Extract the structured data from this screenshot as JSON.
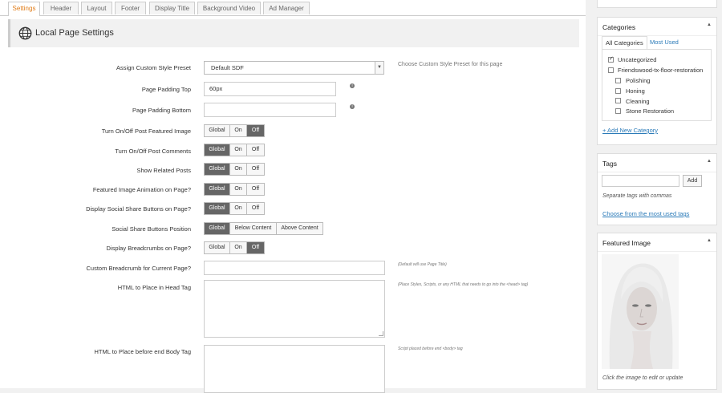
{
  "tabs": [
    "Settings",
    "Header",
    "Layout",
    "Footer",
    "Display Title",
    "Background Video",
    "Ad Manager"
  ],
  "header": {
    "title": "Local Page Settings"
  },
  "fields": {
    "style_preset": {
      "label": "Assign Custom Style Preset",
      "value": "Default SDF",
      "hint": "Choose Custom Style Preset for this page"
    },
    "padding_top": {
      "label": "Page Padding Top",
      "value": "60px"
    },
    "padding_bottom": {
      "label": "Page Padding Bottom",
      "value": ""
    },
    "featured_image": {
      "label": "Turn On/Off Post Featured Image",
      "options": [
        "Global",
        "On",
        "Off"
      ],
      "selected": "Off"
    },
    "comments": {
      "label": "Turn On/Off Post Comments",
      "options": [
        "Global",
        "On",
        "Off"
      ],
      "selected": "Global"
    },
    "related": {
      "label": "Show Related Posts",
      "options": [
        "Global",
        "On",
        "Off"
      ],
      "selected": "Global"
    },
    "animation": {
      "label": "Featured Image Animation on Page?",
      "options": [
        "Global",
        "On",
        "Off"
      ],
      "selected": "Global"
    },
    "social": {
      "label": "Display Social Share Buttons on Page?",
      "options": [
        "Global",
        "On",
        "Off"
      ],
      "selected": "Global"
    },
    "social_position": {
      "label": "Social Share Buttons Position",
      "options": [
        "Global",
        "Below Content",
        "Above Content"
      ],
      "selected": "Global"
    },
    "breadcrumbs": {
      "label": "Display Breadcrumbs on Page?",
      "options": [
        "Global",
        "On",
        "Off"
      ],
      "selected": "Off"
    },
    "custom_breadcrumb": {
      "label": "Custom Breadcrumb for Current Page?",
      "hint": "(Default will use Page Title)"
    },
    "head_html": {
      "label": "HTML to Place in Head Tag",
      "hint": "(Place Styles, Scripts, or any HTML that needs to go into the <head> tag)"
    },
    "body_html": {
      "label": "HTML to Place before end Body Tag",
      "hint": "Script placed before end <body> tag"
    }
  },
  "categories": {
    "title": "Categories",
    "tabs": [
      "All Categories",
      "Most Used"
    ],
    "items": [
      {
        "label": "Uncategorized",
        "checked": true,
        "indent": 0
      },
      {
        "label": "Friendswood-tx-floor-restoration",
        "checked": false,
        "indent": 0
      },
      {
        "label": "Polishing",
        "checked": false,
        "indent": 1
      },
      {
        "label": "Honing",
        "checked": false,
        "indent": 1
      },
      {
        "label": "Cleaning",
        "checked": false,
        "indent": 1
      },
      {
        "label": "Stone Restoration",
        "checked": false,
        "indent": 1
      }
    ],
    "add_new": "+ Add New Category"
  },
  "tags": {
    "title": "Tags",
    "add_button": "Add",
    "hint": "Separate tags with commas",
    "choose_link": "Choose from the most used tags"
  },
  "featured_image": {
    "title": "Featured Image",
    "hint": "Click the image to edit or update"
  },
  "colors": {
    "accent_tab": "#e07b16",
    "selected_button": "#666666",
    "link": "#2a7ab8"
  }
}
